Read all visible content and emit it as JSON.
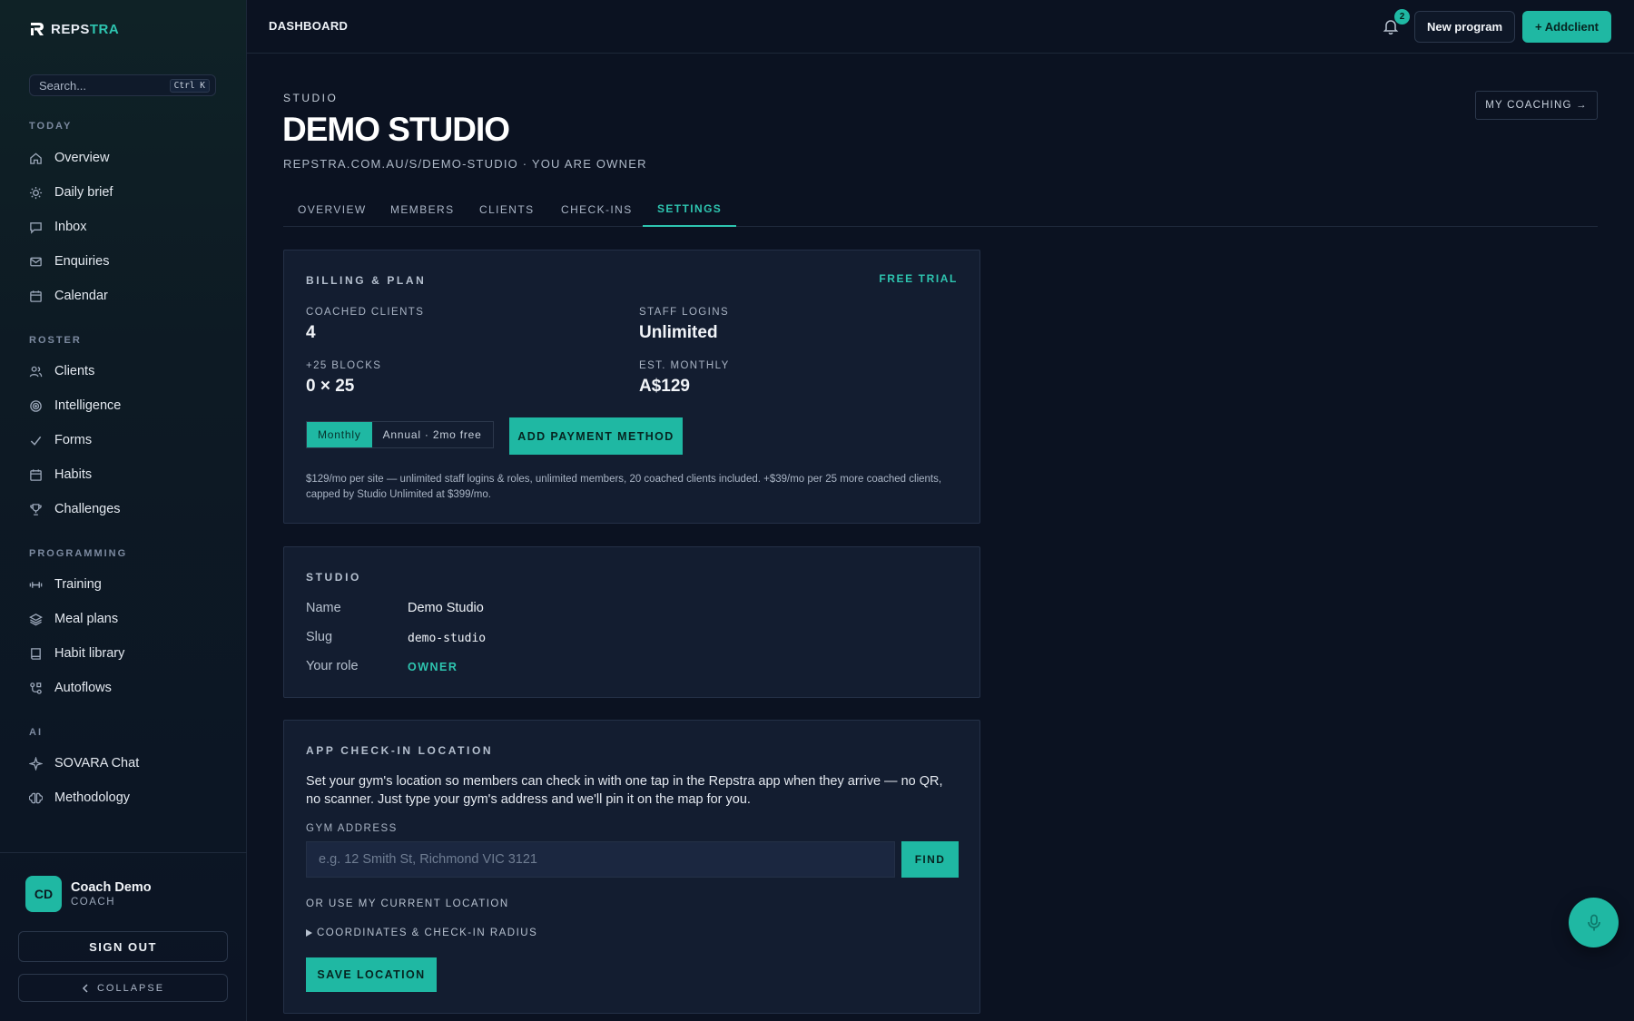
{
  "brand": {
    "name_a": "REPS",
    "name_b": "TRA"
  },
  "search": {
    "placeholder": "Search...",
    "shortcut": "Ctrl K"
  },
  "sidebar": {
    "sections": [
      {
        "title": "TODAY",
        "items": [
          "Overview",
          "Daily brief",
          "Inbox",
          "Enquiries",
          "Calendar"
        ]
      },
      {
        "title": "ROSTER",
        "items": [
          "Clients",
          "Intelligence",
          "Forms",
          "Habits",
          "Challenges"
        ]
      },
      {
        "title": "PROGRAMMING",
        "items": [
          "Training",
          "Meal plans",
          "Habit library",
          "Autoflows"
        ]
      },
      {
        "title": "AI",
        "items": [
          "SOVARA Chat",
          "Methodology"
        ]
      }
    ],
    "user": {
      "initials": "CD",
      "name": "Coach Demo",
      "role": "COACH"
    },
    "sign_out": "SIGN OUT",
    "collapse": "COLLAPSE"
  },
  "topbar": {
    "breadcrumb": "DASHBOARD",
    "notification_count": "2",
    "new_program": "New program",
    "add_client": "+ Addclient"
  },
  "header": {
    "eyebrow": "STUDIO",
    "title": "DEMO STUDIO",
    "subtitle": "REPSTRA.COM.AU/S/DEMO-STUDIO · YOU ARE OWNER",
    "my_coaching": "MY COACHING →"
  },
  "tabs": [
    "OVERVIEW",
    "MEMBERS",
    "CLIENTS",
    "CHECK-INS",
    "SETTINGS"
  ],
  "active_tab": "SETTINGS",
  "billing": {
    "title": "BILLING & PLAN",
    "plan_badge": "FREE TRIAL",
    "stats": [
      {
        "label": "COACHED CLIENTS",
        "value": "4"
      },
      {
        "label": "STAFF LOGINS",
        "value": "Unlimited"
      },
      {
        "label": "+25 BLOCKS",
        "value": "0 × 25"
      },
      {
        "label": "EST. MONTHLY",
        "value": "A$129"
      }
    ],
    "toggle_monthly": "Monthly",
    "toggle_annual": "Annual · 2mo free",
    "add_payment": "ADD PAYMENT METHOD",
    "note": "$129/mo per site — unlimited staff logins & roles, unlimited members, 20 coached clients included. +$39/mo per 25 more coached clients, capped by Studio Unlimited at $399/mo."
  },
  "studio": {
    "title": "STUDIO",
    "name_label": "Name",
    "name_value": "Demo Studio",
    "slug_label": "Slug",
    "slug_value": "demo-studio",
    "role_label": "Your role",
    "role_value": "OWNER"
  },
  "location": {
    "title": "APP CHECK-IN LOCATION",
    "description": "Set your gym's location so members can check in with one tap in the Repstra app when they arrive — no QR, no scanner. Just type your gym's address and we'll pin it on the map for you.",
    "address_label": "GYM ADDRESS",
    "address_placeholder": "e.g. 12 Smith St, Richmond VIC 3121",
    "address_value": "",
    "find": "FIND",
    "use_current": "OR USE MY CURRENT LOCATION",
    "coords_toggle": "COORDINATES & CHECK-IN RADIUS",
    "save": "SAVE LOCATION"
  },
  "colors": {
    "accent": "#1fb8a3",
    "background": "#0b1221",
    "card": "#131d30"
  }
}
